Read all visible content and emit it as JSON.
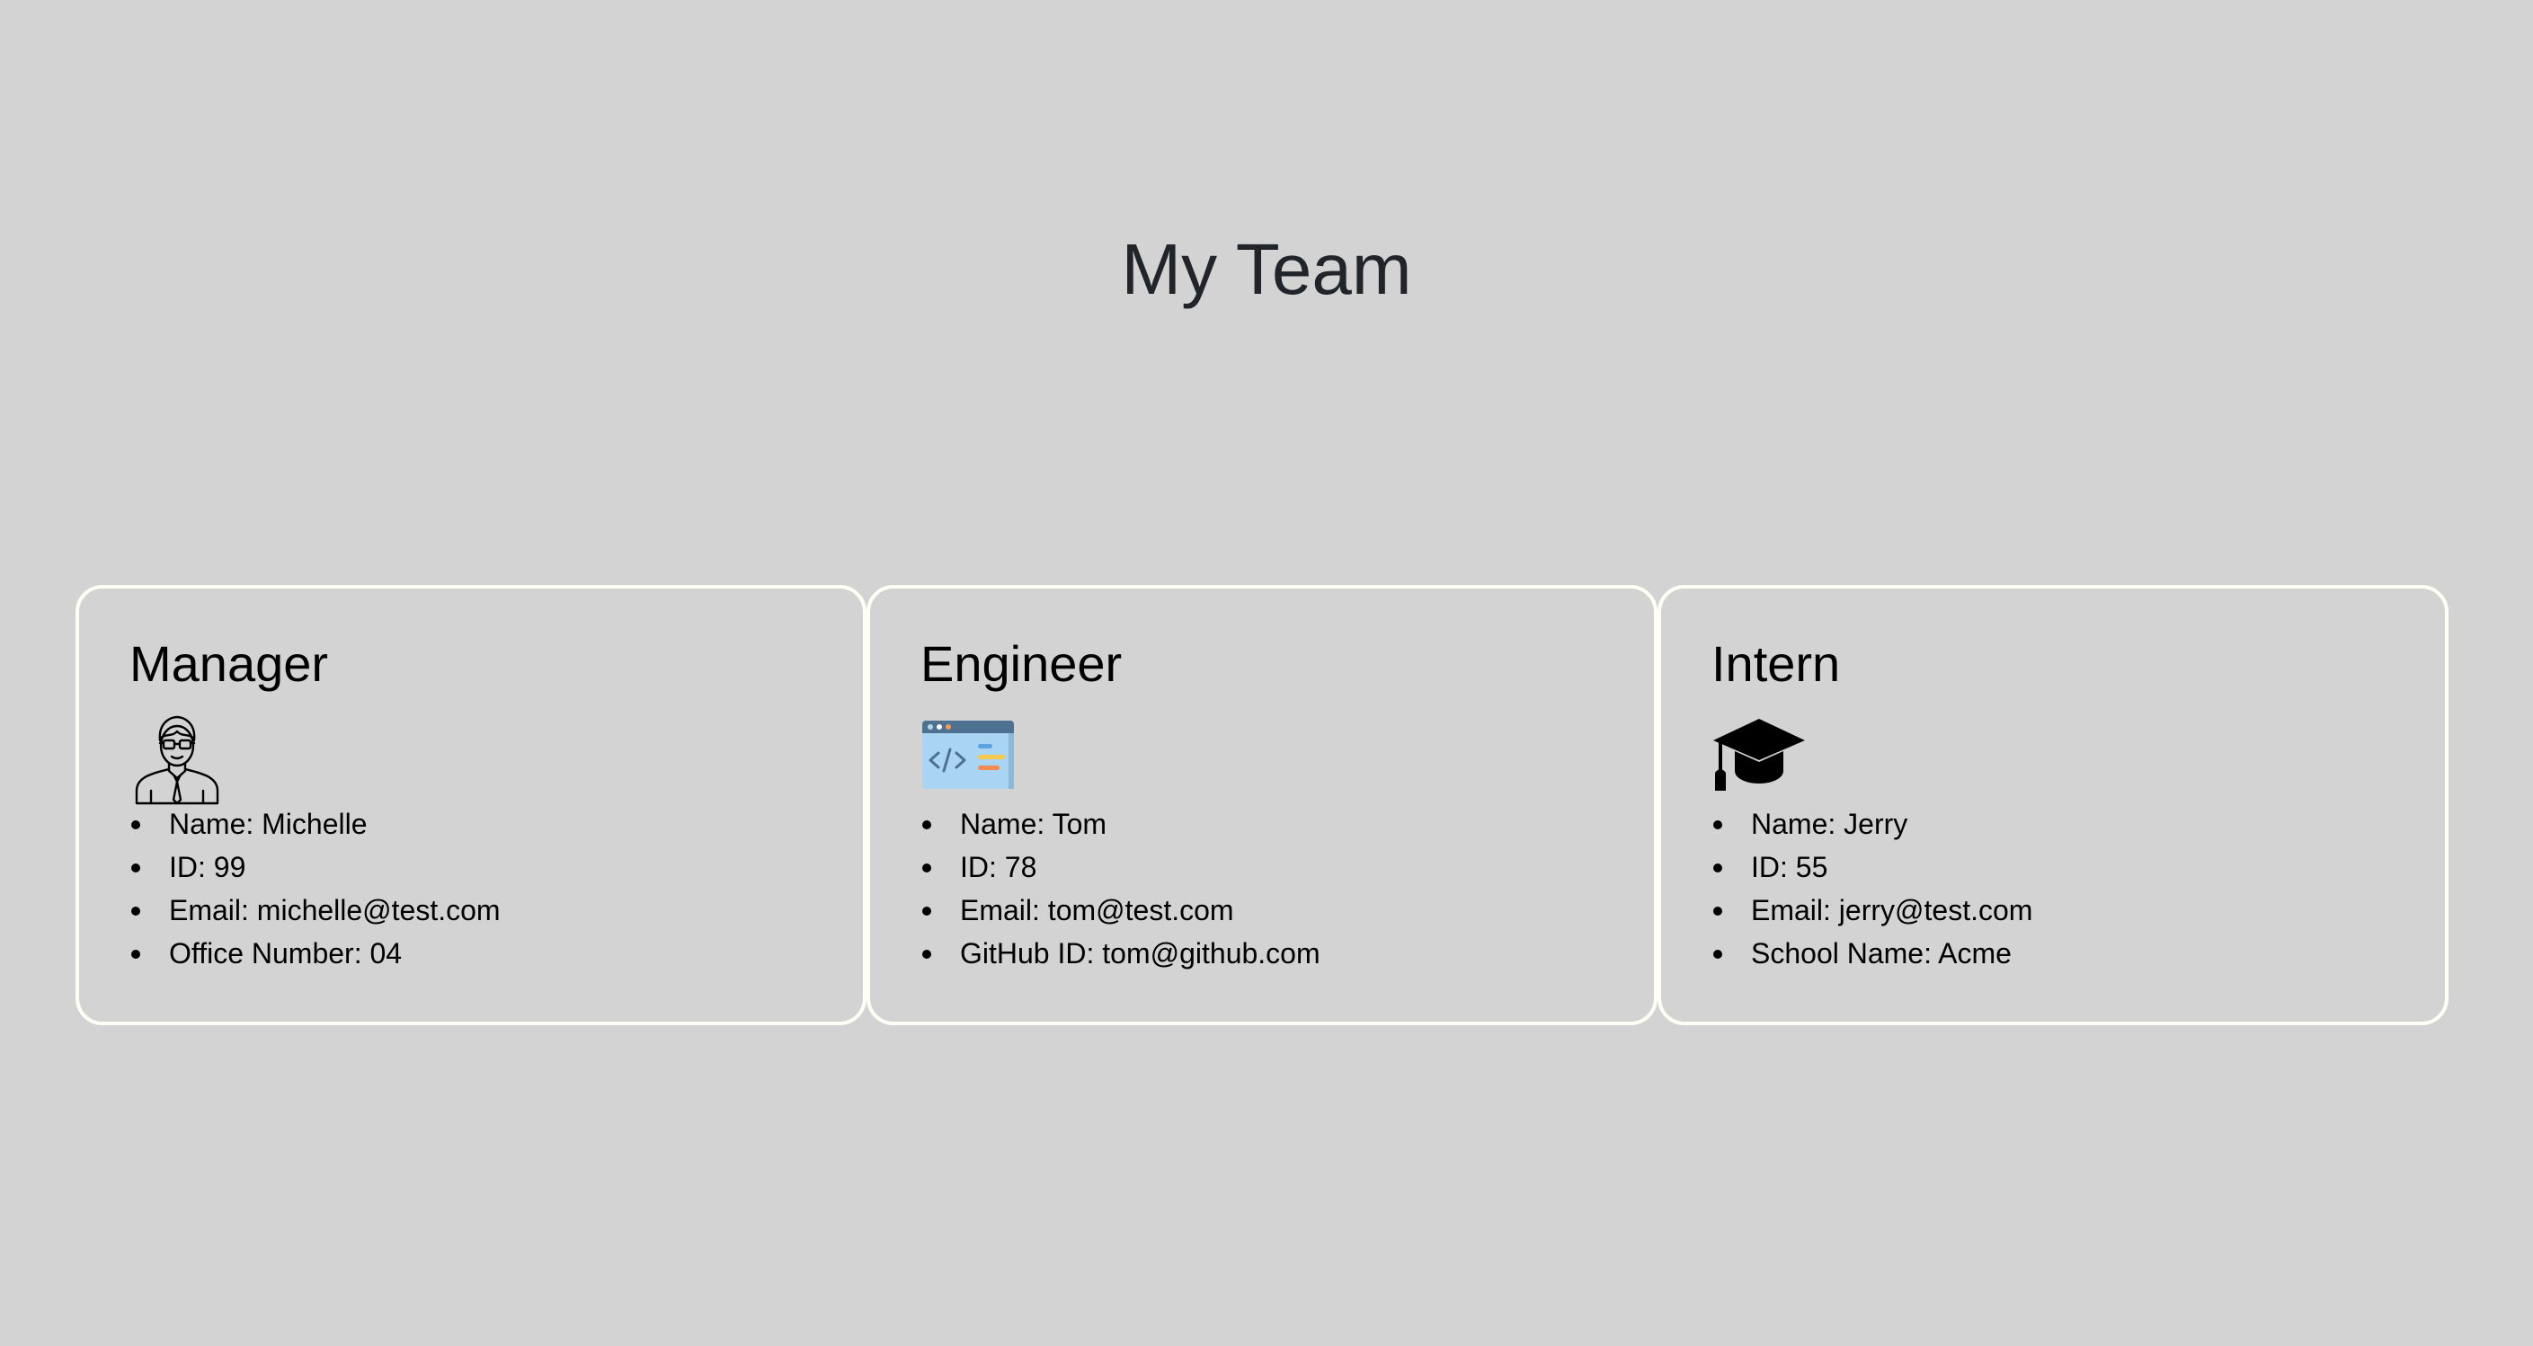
{
  "page": {
    "title": "My Team"
  },
  "cards": [
    {
      "role": "Manager",
      "icon": "manager-avatar-icon",
      "items": [
        "Name: Michelle",
        "ID: 99",
        "Email: michelle@test.com",
        "Office Number: 04"
      ]
    },
    {
      "role": "Engineer",
      "icon": "code-window-icon",
      "items": [
        "Name: Tom",
        "ID: 78",
        "Email: tom@test.com",
        "GitHub ID: tom@github.com"
      ]
    },
    {
      "role": "Intern",
      "icon": "graduation-cap-icon",
      "items": [
        "Name: Jerry",
        "ID: 55",
        "Email: jerry@test.com",
        "School Name: Acme"
      ]
    }
  ],
  "colors": {
    "background": "#d3d3d3",
    "card_border": "#fffff5",
    "title": "#212529"
  }
}
